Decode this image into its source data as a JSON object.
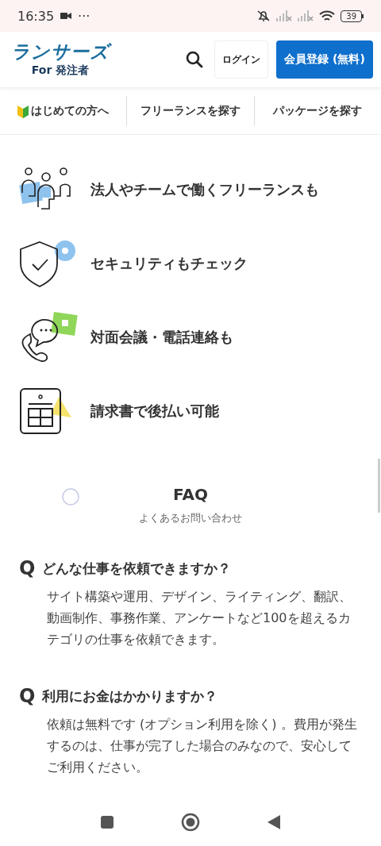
{
  "status_bar": {
    "time": "16:35",
    "more": "···",
    "battery": "39"
  },
  "header": {
    "logo": "ランサーズ",
    "logo_sub": "For 発注者",
    "login": "ログイン",
    "register": "会員登録 (無料)"
  },
  "nav": [
    {
      "label": "はじめての方へ",
      "kind": "beginner"
    },
    {
      "label": "フリーランスを探す",
      "kind": "plain"
    },
    {
      "label": "パッケージを探す",
      "kind": "plain"
    }
  ],
  "features": [
    {
      "text": "法人やチームで働くフリーランスも",
      "kind": "team"
    },
    {
      "text": "セキュリティもチェック",
      "kind": "shield"
    },
    {
      "text": "対面会議・電話連絡も",
      "kind": "phone"
    },
    {
      "text": "請求書で後払い可能",
      "kind": "invoice"
    }
  ],
  "faq": {
    "title": "FAQ",
    "subtitle": "よくあるお問い合わせ",
    "items": [
      {
        "mark": "Q",
        "question": "どんな仕事を依頼できますか？",
        "answer": "サイト構築や運用、デザイン、ライティング、翻訳、動画制作、事務作業、アンケートなど100を超えるカテゴリの仕事を依頼できます。"
      },
      {
        "mark": "Q",
        "question": "利用にお金はかかりますか？",
        "answer": "依頼は無料です (オプション利用を除く) 。費用が発生するのは、仕事が完了した場合のみなので、安心してご利用ください。"
      }
    ]
  }
}
